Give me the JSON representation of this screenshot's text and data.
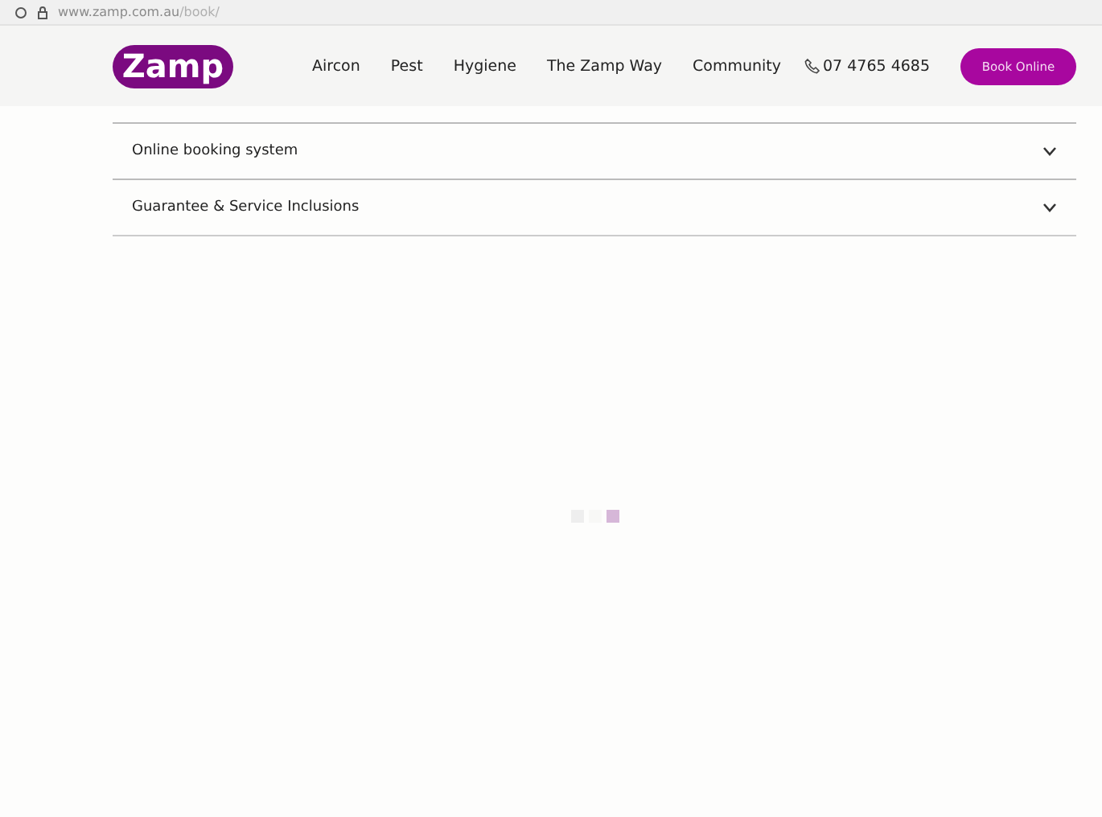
{
  "browser": {
    "url_host": "www.zamp.com.au",
    "url_path": "/book/"
  },
  "header": {
    "logo": "Zamp",
    "nav": [
      "Aircon",
      "Pest",
      "Hygiene",
      "The Zamp Way",
      "Community"
    ],
    "phone": "07 4765 4685",
    "cta": "Book Online"
  },
  "accordion": [
    {
      "title": "Online booking system",
      "expanded": false
    },
    {
      "title": "Guarantee & Service Inclusions",
      "expanded": false
    }
  ]
}
